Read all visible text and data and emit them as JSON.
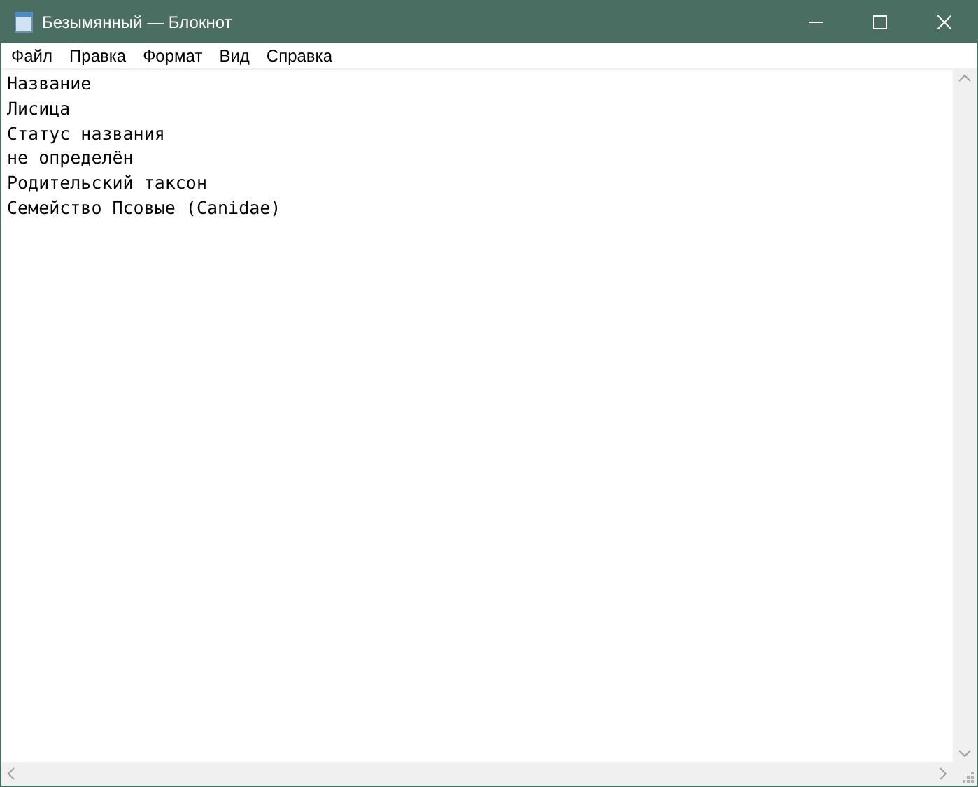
{
  "window": {
    "title": "Безымянный — Блокнот"
  },
  "menu": [
    "Файл",
    "Правка",
    "Формат",
    "Вид",
    "Справка"
  ],
  "editor": {
    "lines": [
      "Название",
      "Лисица",
      "Статус названия",
      "не определён",
      "Родительский таксон",
      "Семейство Псовые (Canidae)"
    ]
  }
}
